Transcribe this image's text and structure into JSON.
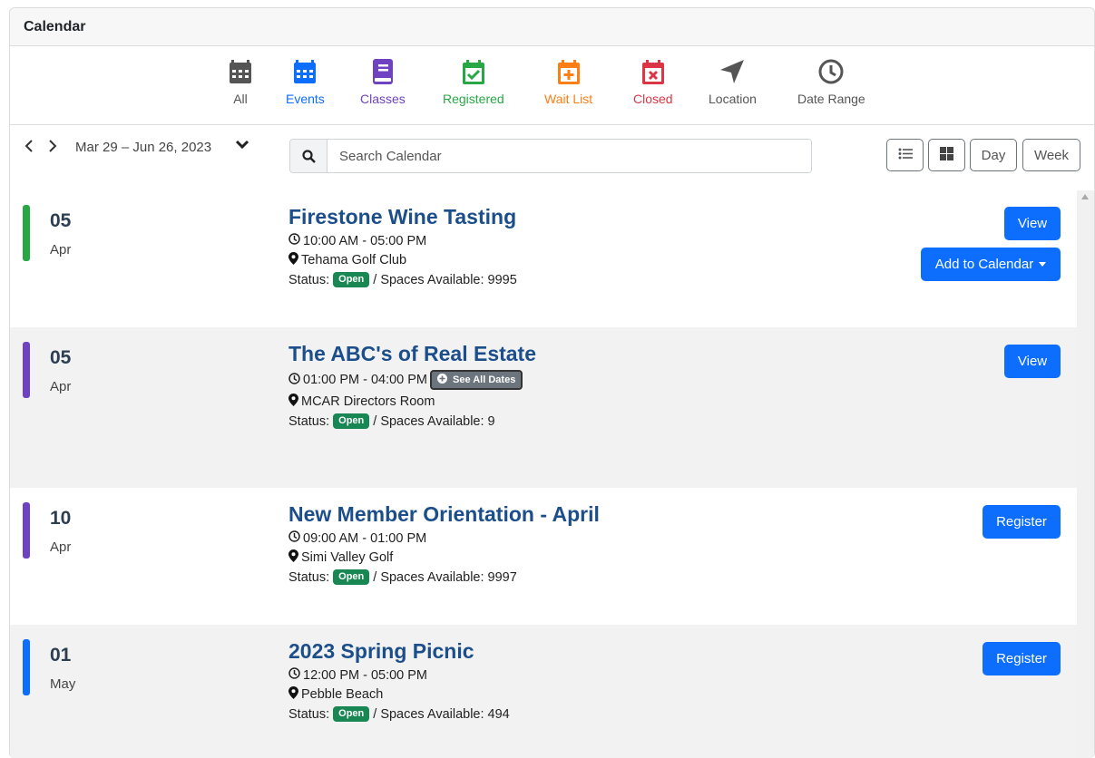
{
  "header": {
    "title": "Calendar"
  },
  "filters": [
    {
      "label": "All",
      "color": "#555555",
      "icon": "calendar-grid-icon"
    },
    {
      "label": "Events",
      "color": "#0d6efd",
      "icon": "calendar-grid-icon"
    },
    {
      "label": "Classes",
      "color": "#6f42c1",
      "icon": "book-icon"
    },
    {
      "label": "Registered",
      "color": "#28a745",
      "icon": "calendar-check-icon"
    },
    {
      "label": "Wait List",
      "color": "#fd7e14",
      "icon": "calendar-plus-icon"
    },
    {
      "label": "Closed",
      "color": "#dc3545",
      "icon": "calendar-x-icon"
    },
    {
      "label": "Location",
      "color": "#555555",
      "icon": "location-arrow-icon"
    },
    {
      "label": "Date Range",
      "color": "#555555",
      "icon": "clock-icon"
    }
  ],
  "toolbar": {
    "date_range": "Mar 29 – Jun 26, 2023",
    "search_placeholder": "Search Calendar",
    "view_day": "Day",
    "view_week": "Week"
  },
  "events": [
    {
      "day": "05",
      "month": "Apr",
      "bar_color": "#28a745",
      "title": "Firestone Wine Tasting",
      "time": "10:00 AM - 05:00 PM",
      "location": "Tehama Golf Club",
      "status_prefix": "Status:",
      "status": "Open",
      "spaces": "/ Spaces Available: 9995",
      "btn1": "View",
      "btn2": "Add to Calendar"
    },
    {
      "day": "05",
      "month": "Apr",
      "bar_color": "#6f42c1",
      "title": "The ABC's of Real Estate",
      "time": "01:00 PM - 04:00 PM",
      "see_all": "See All Dates",
      "location": "MCAR Directors Room",
      "status_prefix": "Status:",
      "status": "Open",
      "spaces": "/ Spaces Available: 9",
      "btn1": "View"
    },
    {
      "day": "10",
      "month": "Apr",
      "bar_color": "#6f42c1",
      "title": "New Member Orientation - April",
      "time": "09:00 AM - 01:00 PM",
      "location": "Simi Valley Golf",
      "status_prefix": "Status:",
      "status": "Open",
      "spaces": "/ Spaces Available: 9997",
      "btn1": "Register"
    },
    {
      "day": "01",
      "month": "May",
      "bar_color": "#0d6efd",
      "title": "2023 Spring Picnic",
      "time": "12:00 PM - 05:00 PM",
      "location": "Pebble Beach",
      "status_prefix": "Status:",
      "status": "Open",
      "spaces": "/ Spaces Available: 494",
      "btn1": "Register"
    }
  ]
}
